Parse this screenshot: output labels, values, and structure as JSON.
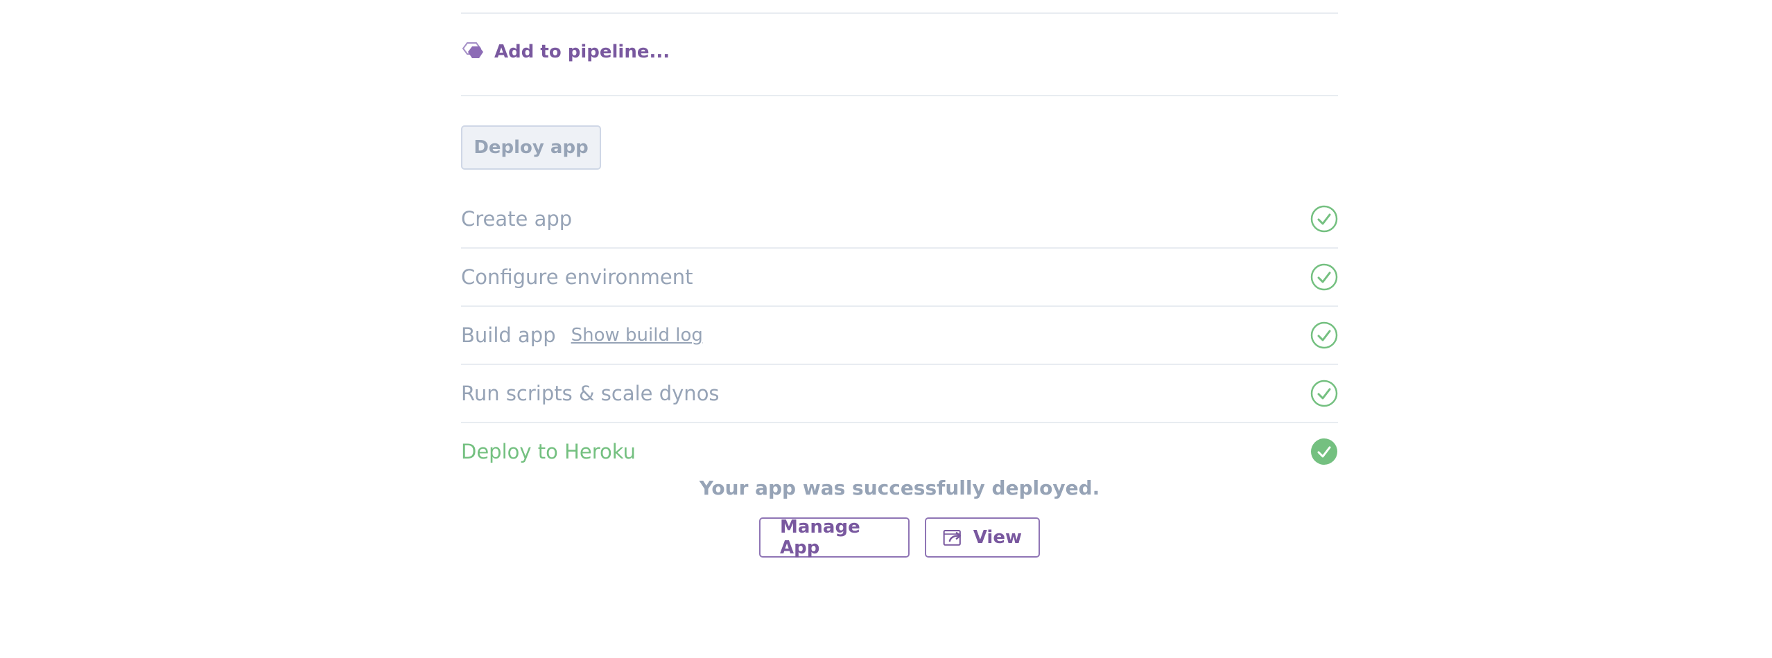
{
  "pipeline": {
    "label": "Add to pipeline...",
    "icon": "pipeline-icon",
    "color": "#79589f"
  },
  "deploy_button": {
    "label": "Deploy app",
    "state": "disabled"
  },
  "steps": [
    {
      "label": "Create app",
      "status": "complete",
      "icon": "check-circle-icon"
    },
    {
      "label": "Configure environment",
      "status": "complete",
      "icon": "check-circle-icon"
    },
    {
      "label": "Build app",
      "link": "Show build log",
      "status": "complete",
      "icon": "check-circle-icon"
    },
    {
      "label": "Run scripts & scale dynos",
      "status": "complete",
      "icon": "check-circle-icon"
    },
    {
      "label": "Deploy to Heroku",
      "status": "complete-highlight",
      "icon": "check-circle-filled-icon"
    }
  ],
  "success_message": "Your app was successfully deployed.",
  "actions": {
    "manage_label": "Manage App",
    "view_label": "View",
    "view_icon": "external-window-icon"
  },
  "colors": {
    "accent": "#79589f",
    "muted": "#96a3b6",
    "success": "#74c080",
    "divider": "#e8ecf1"
  }
}
